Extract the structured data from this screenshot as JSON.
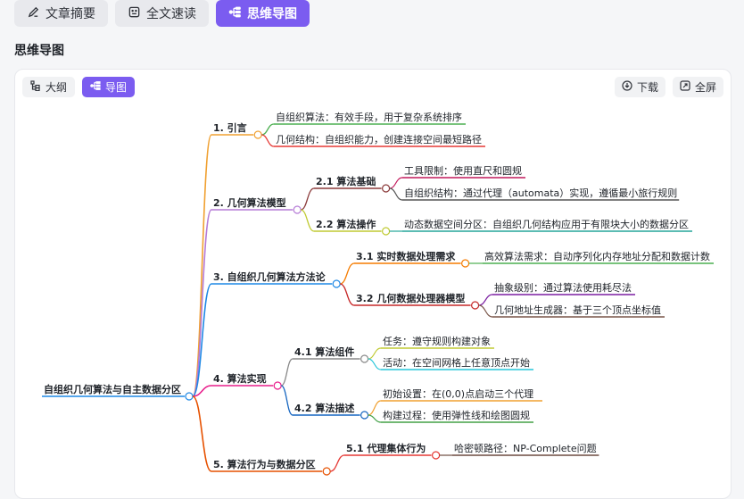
{
  "tabs": [
    {
      "label": "文章摘要",
      "icon": "pen-icon",
      "active": false
    },
    {
      "label": "全文速读",
      "icon": "reader-icon",
      "active": false
    },
    {
      "label": "思维导图",
      "icon": "mindmap-icon",
      "active": true
    }
  ],
  "section_title": "思维导图",
  "view_toggle": {
    "outline_label": "大纲",
    "mindmap_label": "导图"
  },
  "toolbar": {
    "download_label": "下载",
    "fullscreen_label": "全屏"
  },
  "mindmap": {
    "root": "自组织几何算法与自主数据分区",
    "branches": [
      {
        "label": "1. 引言",
        "color": "#f0a030",
        "children": [
          {
            "label": "自组织算法：有效手段，用于复杂系统排序",
            "color": "#4caf50"
          },
          {
            "label": "几何结构：自组织能力，创建连接空间最短路径",
            "color": "#e53935"
          }
        ]
      },
      {
        "label": "2. 几何算法模型",
        "color": "#b57bd6",
        "children": [
          {
            "label": "2.1 算法基础",
            "color": "#8b3a3a",
            "children": [
              {
                "label": "工具限制：使用直尺和圆规",
                "color": "#c2185b"
              },
              {
                "label": "自组织结构：通过代理（automata）实现，遵循最小旅行规则",
                "color": "#555555"
              }
            ]
          },
          {
            "label": "2.2 算法操作",
            "color": "#c0ca33",
            "children": [
              {
                "label": "动态数据空间分区：自组织几何结构应用于有限块大小的数据分区",
                "color": "#26a69a"
              }
            ]
          }
        ]
      },
      {
        "label": "3. 自组织几何算法方法论",
        "color": "#1e88e5",
        "children": [
          {
            "label": "3.1 实时数据处理需求",
            "color": "#f57c00",
            "children": [
              {
                "label": "高效算法需求：自动序列化内存地址分配和数据计数",
                "color": "#4caf50"
              }
            ]
          },
          {
            "label": "3.2 几何数据处理器模型",
            "color": "#c62828",
            "children": [
              {
                "label": "抽象级别：通过算法使用耗尽法",
                "color": "#7b1fa2"
              },
              {
                "label": "几何地址生成器：基于三个顶点坐标值",
                "color": "#795548"
              }
            ]
          }
        ]
      },
      {
        "label": "4. 算法实现",
        "color": "#e91e8c",
        "children": [
          {
            "label": "4.1 算法组件",
            "color": "#888888",
            "children": [
              {
                "label": "任务：遵守规则构建对象",
                "color": "#c0ca33"
              },
              {
                "label": "活动：在空间网格上任意顶点开始",
                "color": "#26c6da"
              }
            ]
          },
          {
            "label": "4.2 算法描述",
            "color": "#1565c0",
            "children": [
              {
                "label": "初始设置：在(0,0)点启动三个代理",
                "color": "#f0a030"
              },
              {
                "label": "构建过程：使用弹性线和绘图圆规",
                "color": "#43a047"
              }
            ]
          }
        ]
      },
      {
        "label": "5. 算法行为与数据分区",
        "color": "#e65100",
        "children": [
          {
            "label": "5.1 代理集体行为",
            "color": "#e53935",
            "children": [
              {
                "label": "哈密顿路径：NP-Complete问题",
                "color": "#6d4c41"
              }
            ]
          }
        ]
      }
    ]
  }
}
